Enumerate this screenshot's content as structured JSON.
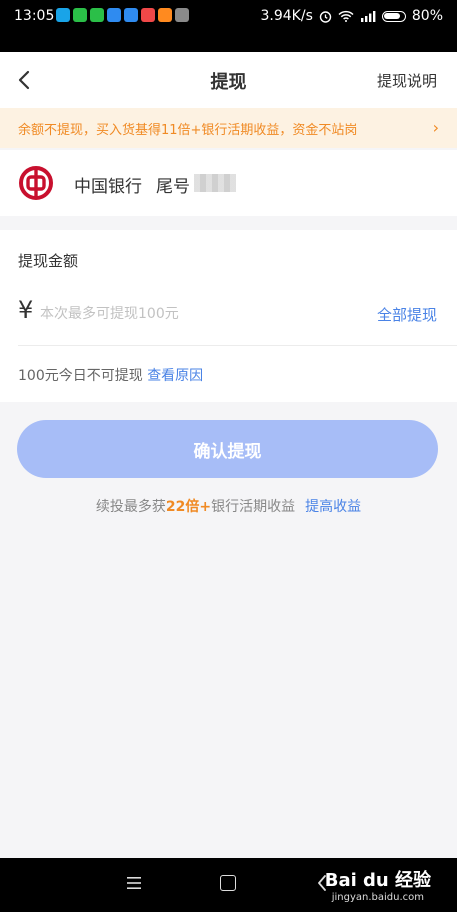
{
  "status_bar": {
    "time": "13:05",
    "network_speed": "3.94K/s",
    "battery": "80%",
    "app_icon_colors": [
      "#19a4e8",
      "#2bbf48",
      "#2bbf48",
      "#2f8bf0",
      "#2f8bf0",
      "#f04848",
      "#ff8a1f",
      "#8a8a8a"
    ]
  },
  "nav": {
    "title": "提现",
    "help_label": "提现说明"
  },
  "notice": {
    "text": "余额不提现，买入货基得11倍+银行活期收益，资金不站岗",
    "chevron": "›"
  },
  "bank": {
    "name": "中国银行",
    "tail_label": "尾号",
    "logo_color": "#c8102e"
  },
  "withdraw": {
    "amount_label": "提现金额",
    "currency_symbol": "¥",
    "amount_placeholder": "本次最多可提现100元",
    "withdraw_all_label": "全部提现",
    "limit_text": "100元今日不可提现",
    "limit_link": "查看原因",
    "confirm_label": "确认提现"
  },
  "promo": {
    "prefix": "续投最多获",
    "highlight": "22倍",
    "plus": "+",
    "suffix": "银行活期收益",
    "link": "提高收益"
  },
  "watermark": {
    "brand": "Bai du 经验",
    "url": "jingyan.baidu.com"
  },
  "colors": {
    "accent_blue": "#4a83e6",
    "accent_orange": "#f08a24",
    "button_disabled": "#a7bdf7",
    "notice_bg": "#fdf2e2"
  }
}
